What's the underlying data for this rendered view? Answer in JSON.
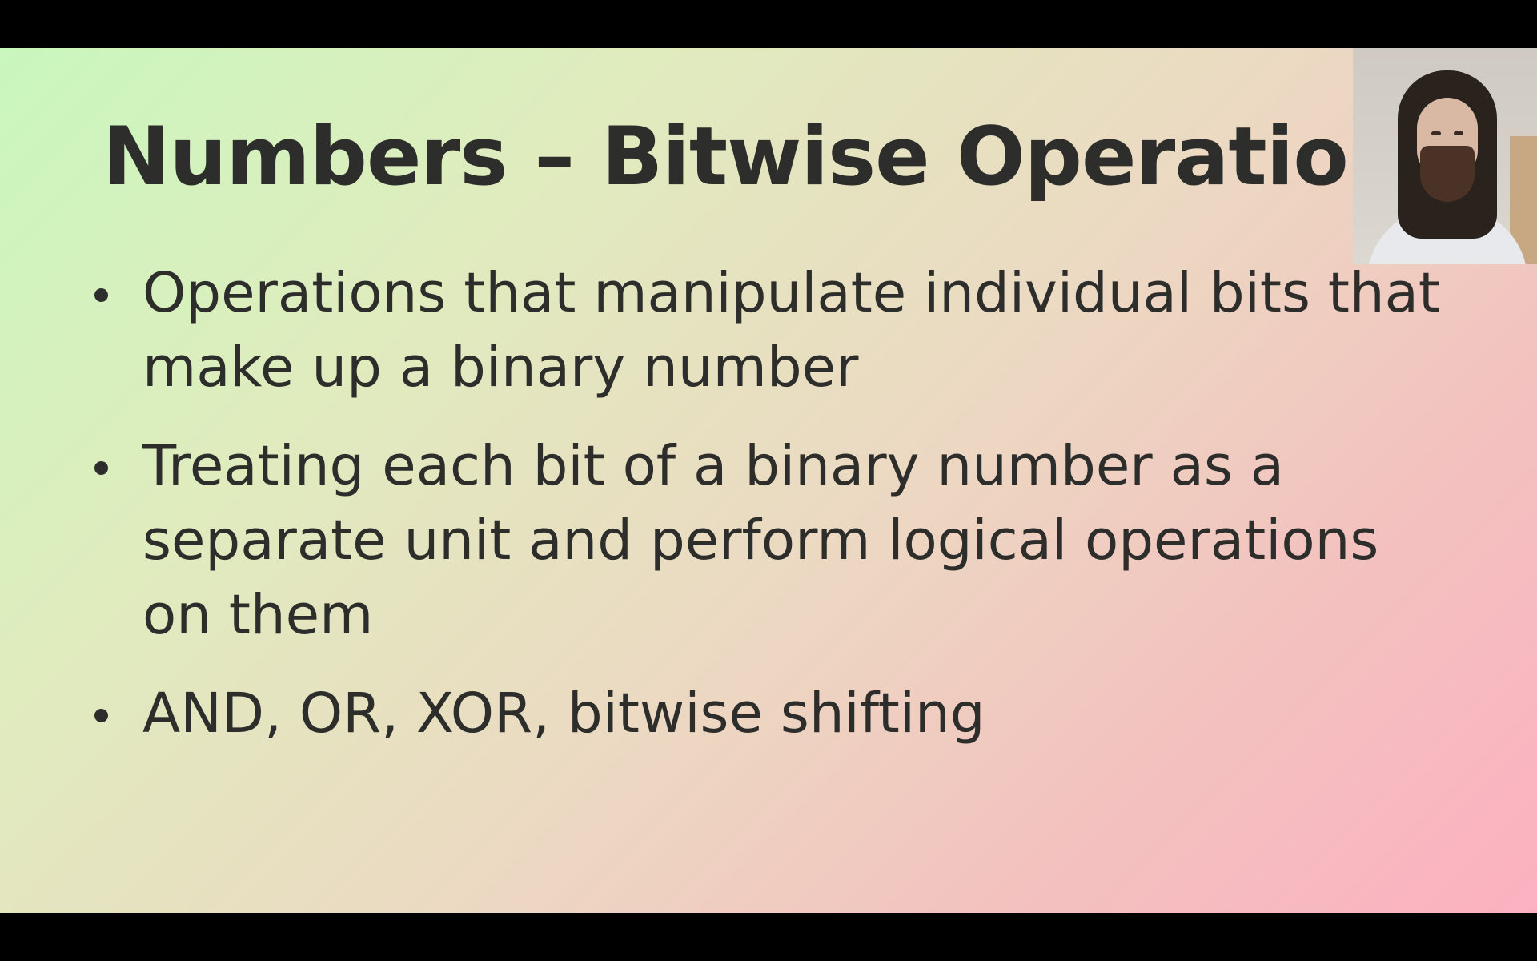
{
  "slide": {
    "title": "Numbers – Bitwise Operations",
    "bullets": [
      {
        "text": "Operations that manipulate individual bits that make up a binary number"
      },
      {
        "text": "Treating each bit of a binary number as a separate unit and perform logical operations on them"
      },
      {
        "text": "AND, OR, XOR, bitwise shifting"
      }
    ],
    "colors": {
      "text": "#2d2e2b",
      "gradient_start": "#c9f7bd",
      "gradient_end": "#fcb1c0",
      "letterbox": "#000000"
    }
  },
  "webcam": {
    "subject": "presenter-webcam-video"
  }
}
